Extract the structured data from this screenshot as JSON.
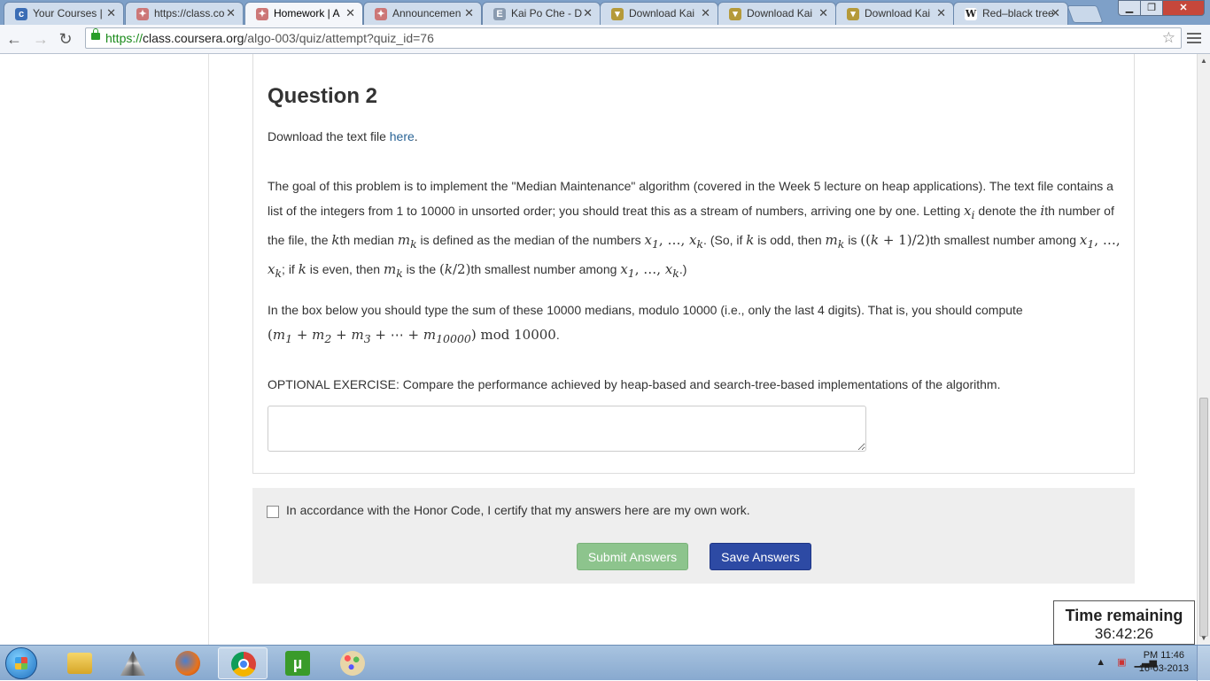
{
  "browser": {
    "tabs": [
      {
        "title": "Your Courses | ",
        "icon": "coursera-icon",
        "active": false
      },
      {
        "title": "https://class.co",
        "icon": "coursera-favicon-icon",
        "active": false
      },
      {
        "title": "Homework | A",
        "icon": "coursera-favicon-icon",
        "active": true
      },
      {
        "title": "Announcemen",
        "icon": "coursera-favicon-icon",
        "active": false
      },
      {
        "title": "Kai Po Che - D",
        "icon": "page-icon",
        "active": false
      },
      {
        "title": "Download Kai",
        "icon": "shield-icon",
        "active": false
      },
      {
        "title": "Download Kai",
        "icon": "shield-icon",
        "active": false
      },
      {
        "title": "Download Kai",
        "icon": "shield-icon",
        "active": false
      },
      {
        "title": "Red–black tree",
        "icon": "wikipedia-icon",
        "active": false
      }
    ],
    "url": {
      "scheme": "https://",
      "host": "class.coursera.org",
      "path": "/algo-003/quiz/attempt?quiz_id=76"
    }
  },
  "question": {
    "title": "Question 2",
    "download_prefix": "Download the text file ",
    "download_link": "here",
    "download_suffix": ".",
    "optional_exercise": "OPTIONAL EXERCISE: Compare the performance achieved by heap-based and search-tree-based implementations of the algorithm.",
    "answer_value": ""
  },
  "honor": {
    "checked": false,
    "text": "In accordance with the Honor Code, I certify that my answers here are my own work.",
    "submit_label": "Submit Answers",
    "save_label": "Save Answers",
    "submit_color": "#8dc48d",
    "save_color": "#2d4aa4"
  },
  "timer": {
    "label": "Time remaining",
    "value": "36:42:26"
  },
  "taskbar": {
    "items": [
      "windows-explorer-icon",
      "vlc-triangle-icon",
      "firefox-icon",
      "chrome-icon",
      "utorrent-icon",
      "paint-icon"
    ],
    "active_item": "chrome-icon",
    "time": "PM 11:46",
    "date": "16-03-2013"
  }
}
